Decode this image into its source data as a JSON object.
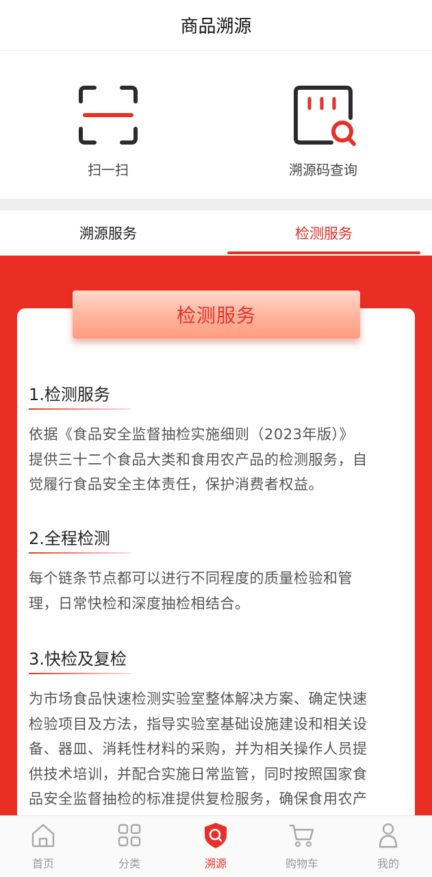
{
  "header": {
    "title": "商品溯源"
  },
  "quick_actions": [
    {
      "label": "扫一扫",
      "icon": "scan-icon"
    },
    {
      "label": "溯源码查询",
      "icon": "trace-code-search-icon"
    }
  ],
  "tabs": [
    {
      "label": "溯源服务",
      "active": false
    },
    {
      "label": "检测服务",
      "active": true
    }
  ],
  "card": {
    "ribbon_title": "检测服务",
    "sections": [
      {
        "title": "1.检测服务",
        "lines": [
          "依据《食品安全监督抽检实施细则（2023年版）》",
          "提供三十二个食品大类和食用农产品的检测服务，自",
          "觉履行食品安全主体责任，保护消费者权益。"
        ]
      },
      {
        "title": "2.全程检测",
        "lines": [
          "每个链条节点都可以进行不同程度的质量检验和管",
          "理，日常快检和深度抽检相结合。"
        ]
      },
      {
        "title": "3.快检及复检",
        "lines": [
          "为市场食品快速检测实验室整体解决方案、确定快速",
          "检验项目及方法，指导实验室基础设施建设和相关设",
          "备、器皿、消耗性材料的采购，并为相关操作人员提",
          "供技术培训，并配合实施日常监管，同时按照国家食",
          "品安全监督抽检的标准提供复检服务，确保食用农产"
        ]
      }
    ]
  },
  "tabbar": [
    {
      "label": "首页",
      "icon": "home-icon",
      "active": false
    },
    {
      "label": "分类",
      "icon": "category-grid-icon",
      "active": false
    },
    {
      "label": "溯源",
      "icon": "trace-shield-icon",
      "active": true
    },
    {
      "label": "购物车",
      "icon": "cart-icon",
      "active": false
    },
    {
      "label": "我的",
      "icon": "user-icon",
      "active": false
    }
  ],
  "colors": {
    "accent": "#e8302a",
    "background_red": "#ea2e24",
    "ribbon": "#ffb39c"
  }
}
